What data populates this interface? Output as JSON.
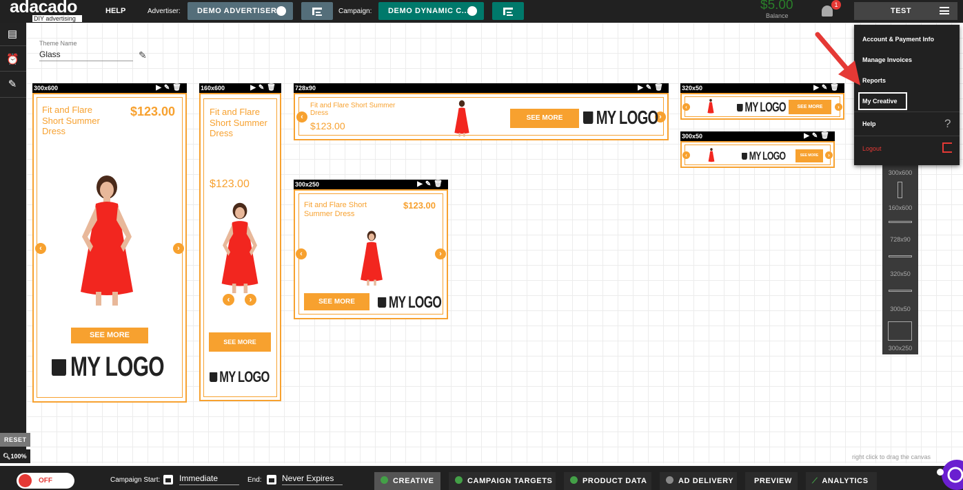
{
  "app": {
    "logo_ad": "ad",
    "logo_rest": "acado",
    "logo_sub": "DIY advertising"
  },
  "topbar": {
    "help": "HELP",
    "advertiser_label": "Advertiser:",
    "advertiser_value": "DEMO ADVERTISER",
    "campaign_label": "Campaign:",
    "campaign_value": "DEMO DYNAMIC C...",
    "balance_value": "$5.00",
    "balance_label": "Balance",
    "notification_count": "1",
    "user": "TEST"
  },
  "theme": {
    "label": "Theme Name",
    "value": "Glass"
  },
  "ads": {
    "product_title": "Fit and Flare Short Summer Dress",
    "price": "$123.00",
    "cta": "SEE MORE",
    "logo_text": "MY LOGO",
    "sizes": [
      "300x600",
      "160x600",
      "728x90",
      "320x50",
      "300x50",
      "300x250"
    ]
  },
  "menu": {
    "items": [
      "Account & Payment Info",
      "Manage Invoices",
      "Reports",
      "My Creative",
      "Help",
      "Logout"
    ],
    "help_icon": "?"
  },
  "palette": {
    "items": [
      "300x600",
      "160x600",
      "728x90",
      "320x50",
      "300x50",
      "300x250"
    ]
  },
  "canvas": {
    "reset": "RESET",
    "zoom": "100%",
    "drag_hint": "right click to drag the canvas"
  },
  "bottombar": {
    "toggle": "OFF",
    "start_label": "Campaign Start:",
    "start_value": "Immediate",
    "end_label": "End:",
    "end_value": "Never Expires",
    "tabs": [
      "CREATIVE",
      "CAMPAIGN TARGETS",
      "PRODUCT DATA",
      "AD DELIVERY",
      "PREVIEW",
      "ANALYTICS"
    ]
  },
  "colors": {
    "accent_orange": "#f7a12f",
    "dark": "#212121",
    "green": "#00796b",
    "advertiser_btn": "#546e7a",
    "tab_check_green": "#43a047"
  }
}
